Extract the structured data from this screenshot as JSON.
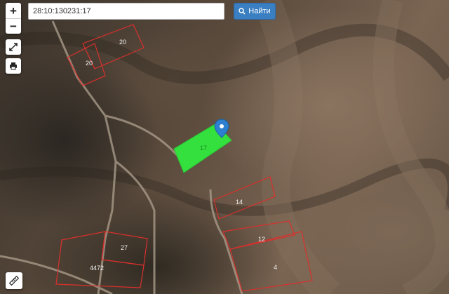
{
  "search": {
    "value": "28:10:130231:17",
    "button_label": "Найти"
  },
  "controls": {
    "zoom_in": "+",
    "zoom_out": "−",
    "fullscreen_icon": "expand-icon",
    "print_icon": "printer-icon",
    "ruler_icon": "ruler-icon"
  },
  "parcels": {
    "selected": {
      "label": "17",
      "color": "#33e03d"
    },
    "others": [
      {
        "label": "20",
        "key": "p20a"
      },
      {
        "label": "20",
        "key": "p20b"
      },
      {
        "label": "14",
        "key": "p14"
      },
      {
        "label": "12",
        "key": "p12"
      },
      {
        "label": "4",
        "key": "p4"
      },
      {
        "label": "27",
        "key": "p27"
      },
      {
        "label": "4472",
        "key": "p4472"
      }
    ],
    "outline_color": "#d9302c"
  },
  "marker": {
    "icon": "map-pin-icon",
    "color": "#2d7fd0"
  }
}
